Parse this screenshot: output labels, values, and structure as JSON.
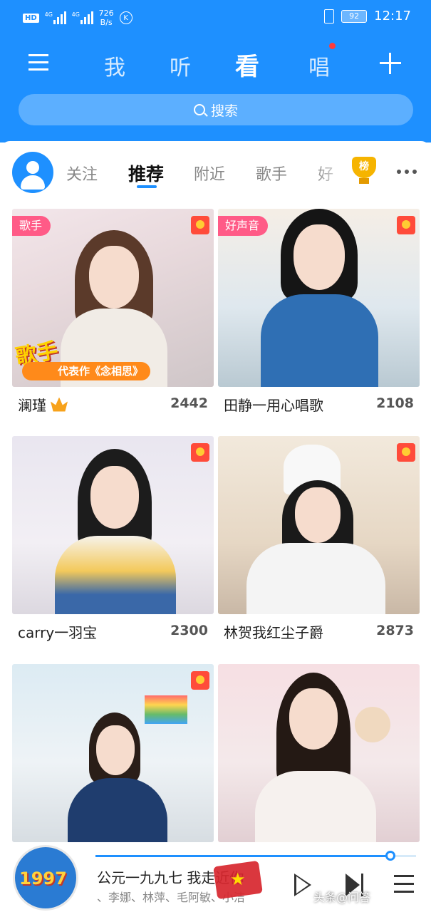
{
  "status_bar": {
    "hd": "HD",
    "network_1": "4G",
    "network_2": "4G",
    "speed_value": "726",
    "speed_unit": "B/s",
    "k": "K",
    "battery": "92",
    "time": "12:17"
  },
  "nav": {
    "tabs": [
      "我",
      "听",
      "看",
      "唱"
    ],
    "active_tab": "看"
  },
  "search": {
    "placeholder": "搜索"
  },
  "category_tabs": {
    "items": [
      "关注",
      "推荐",
      "附近",
      "歌手",
      "好"
    ],
    "active": "推荐",
    "rank_label": "榜"
  },
  "rooms": [
    {
      "tag": "歌手",
      "promo": "代表作《念相思》",
      "promo_badge": "歌手",
      "name": "澜瑾",
      "count": "2442"
    },
    {
      "tag": "好声音",
      "name": "田静一用心唱歌",
      "count": "2108"
    },
    {
      "name": "carry一羽宝",
      "count": "2300"
    },
    {
      "name": "林贺我红尘子爵",
      "count": "2873"
    },
    {
      "name": "",
      "count": ""
    },
    {
      "name": "",
      "count": ""
    }
  ],
  "player": {
    "title": "公元一九九七 我走近你",
    "artists": "、李娜、林萍、毛阿敏、小洁",
    "disc_text": "1997",
    "progress": 0.92
  },
  "watermark": {
    "text": "头条@问答"
  },
  "colors": {
    "primary": "#1e90ff",
    "tag_pink": "#ff5b87",
    "red_packet": "#ff4b3a",
    "gold": "#f6b400"
  }
}
